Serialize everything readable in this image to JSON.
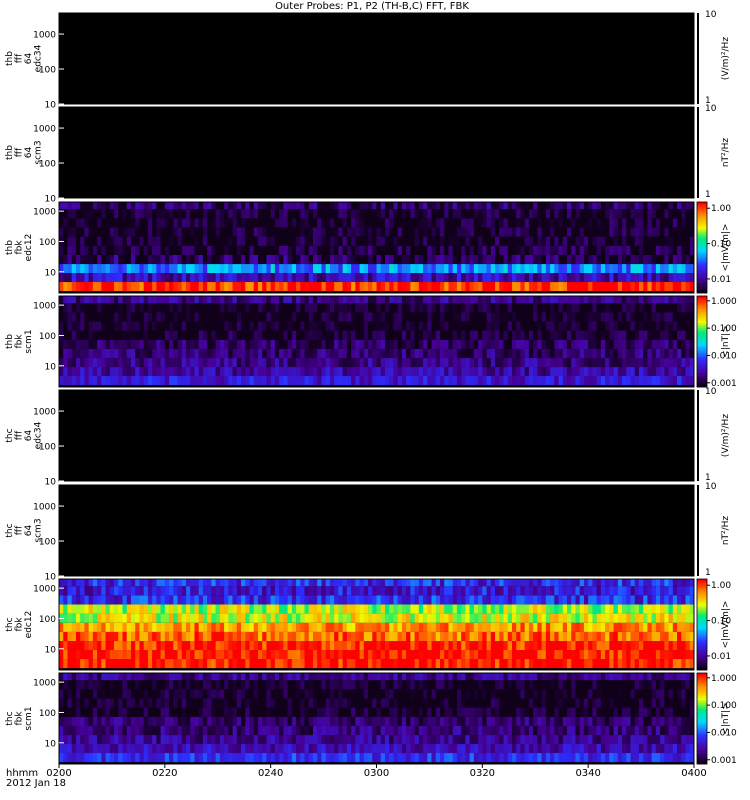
{
  "chart_data": {
    "type": "heatmap",
    "title": "Outer Probes: P1, P2 (TH-B,C) FFT, FBK",
    "time_axis": {
      "label_line1": "hhmm",
      "label_line2": "2012 Jan 18",
      "ticks": [
        "0200",
        "0220",
        "0240",
        "0300",
        "0320",
        "0340",
        "0400"
      ]
    },
    "panels": [
      {
        "ylabel": [
          "thb",
          "fff",
          "64",
          "edc34"
        ],
        "yticks": [
          "1000",
          "100",
          "10"
        ],
        "ylim": [
          10,
          4000
        ],
        "cbar_label": "(V/m)²/Hz",
        "cbar_ticks": [
          "10",
          "1"
        ],
        "cbar": "blank",
        "content": "empty",
        "bands": []
      },
      {
        "ylabel": [
          "thb",
          "fff",
          "64",
          "scm3"
        ],
        "yticks": [
          "1000",
          "100",
          "10"
        ],
        "ylim": [
          10,
          4000
        ],
        "cbar_label": "nT²/Hz",
        "cbar_ticks": [
          "10",
          "1"
        ],
        "cbar": "blank",
        "content": "empty",
        "bands": []
      },
      {
        "ylabel": [
          "thb",
          "fbk",
          "edc12"
        ],
        "yticks": [
          "1000",
          "100",
          "10"
        ],
        "ylim": [
          2,
          2000
        ],
        "cbar_label": "<|mV/m|>",
        "cbar_ticks": [
          "1.00",
          "0.10",
          "0.01"
        ],
        "cbar_range": [
          0.004,
          1.5
        ],
        "cbar": "rainbow",
        "content": "spectrogram",
        "bands": [
          {
            "f0": 2.3,
            "f1": 4.6,
            "value": 1.2
          },
          {
            "f0": 4.6,
            "f1": 9.1,
            "value": 0.012
          },
          {
            "f0": 9.1,
            "f1": 18,
            "value": 0.04
          },
          {
            "f0": 18,
            "f1": 36,
            "value": 0.006
          },
          {
            "f0": 36,
            "f1": 72,
            "value": 0.0045
          },
          {
            "f0": 72,
            "f1": 145,
            "value": 0.004
          },
          {
            "f0": 145,
            "f1": 290,
            "value": 0.004
          },
          {
            "f0": 290,
            "f1": 580,
            "value": 0.004
          },
          {
            "f0": 580,
            "f1": 1160,
            "value": 0.004
          },
          {
            "f0": 1160,
            "f1": 2000,
            "value": 0.006
          }
        ]
      },
      {
        "ylabel": [
          "thb",
          "fbk",
          "scm1"
        ],
        "yticks": [
          "1000",
          "100",
          "10"
        ],
        "ylim": [
          2,
          2000
        ],
        "cbar_label": "<|nT|>",
        "cbar_ticks": [
          "1.000",
          "0.100",
          "0.010",
          "0.001"
        ],
        "cbar_range": [
          0.0007,
          1.5
        ],
        "cbar": "rainbow",
        "content": "spectrogram",
        "bands": [
          {
            "f0": 2.3,
            "f1": 4.6,
            "value": 0.004
          },
          {
            "f0": 4.6,
            "f1": 9.1,
            "value": 0.0025
          },
          {
            "f0": 9.1,
            "f1": 18,
            "value": 0.0018
          },
          {
            "f0": 18,
            "f1": 36,
            "value": 0.0015
          },
          {
            "f0": 36,
            "f1": 72,
            "value": 0.0013
          },
          {
            "f0": 72,
            "f1": 145,
            "value": 0.0008
          },
          {
            "f0": 145,
            "f1": 290,
            "value": 0.0007
          },
          {
            "f0": 290,
            "f1": 580,
            "value": 0.0007
          },
          {
            "f0": 580,
            "f1": 1160,
            "value": 0.0007
          },
          {
            "f0": 1160,
            "f1": 2000,
            "value": 0.0018
          }
        ]
      },
      {
        "ylabel": [
          "thc",
          "fff",
          "64",
          "edc34"
        ],
        "yticks": [
          "1000",
          "100",
          "10"
        ],
        "ylim": [
          10,
          4000
        ],
        "cbar_label": "(V/m)²/Hz",
        "cbar_ticks": [
          "10",
          "1"
        ],
        "cbar": "blank",
        "content": "empty",
        "bands": []
      },
      {
        "ylabel": [
          "thc",
          "fff",
          "64",
          "scm3"
        ],
        "yticks": [
          "1000",
          "100",
          "10"
        ],
        "ylim": [
          10,
          4000
        ],
        "cbar_label": "nT²/Hz",
        "cbar_ticks": [
          "10",
          "1"
        ],
        "cbar": "blank",
        "content": "empty",
        "bands": []
      },
      {
        "ylabel": [
          "thc",
          "fbk",
          "edc12"
        ],
        "yticks": [
          "1000",
          "100",
          "10"
        ],
        "ylim": [
          2,
          2000
        ],
        "cbar_label": "<|mV/m|>",
        "cbar_ticks": [
          "1.00",
          "0.10",
          "0.01"
        ],
        "cbar_range": [
          0.004,
          1.5
        ],
        "cbar": "rainbow",
        "content": "spectrogram",
        "bands": [
          {
            "f0": 2.3,
            "f1": 4.6,
            "value": 1.4
          },
          {
            "f0": 4.6,
            "f1": 9.1,
            "value": 1.4
          },
          {
            "f0": 9.1,
            "f1": 18,
            "value": 1.3
          },
          {
            "f0": 18,
            "f1": 36,
            "value": 0.8
          },
          {
            "f0": 36,
            "f1": 72,
            "value": 0.6
          },
          {
            "f0": 72,
            "f1": 145,
            "value": 0.3
          },
          {
            "f0": 145,
            "f1": 290,
            "value": 0.25
          },
          {
            "f0": 290,
            "f1": 580,
            "value": 0.02
          },
          {
            "f0": 580,
            "f1": 1160,
            "value": 0.016
          },
          {
            "f0": 1160,
            "f1": 2000,
            "value": 0.02
          }
        ]
      },
      {
        "ylabel": [
          "thc",
          "fbk",
          "scm1"
        ],
        "yticks": [
          "1000",
          "100",
          "10"
        ],
        "ylim": [
          2,
          2000
        ],
        "cbar_label": "<|nT|>",
        "cbar_ticks": [
          "1.000",
          "0.100",
          "0.010",
          "0.001"
        ],
        "cbar_range": [
          0.0007,
          1.5
        ],
        "cbar": "rainbow",
        "content": "spectrogram",
        "bands": [
          {
            "f0": 2.3,
            "f1": 4.6,
            "value": 0.006
          },
          {
            "f0": 4.6,
            "f1": 9.1,
            "value": 0.003
          },
          {
            "f0": 9.1,
            "f1": 18,
            "value": 0.002
          },
          {
            "f0": 18,
            "f1": 36,
            "value": 0.0016
          },
          {
            "f0": 36,
            "f1": 72,
            "value": 0.0014
          },
          {
            "f0": 72,
            "f1": 145,
            "value": 0.0008
          },
          {
            "f0": 145,
            "f1": 290,
            "value": 0.0007
          },
          {
            "f0": 290,
            "f1": 580,
            "value": 0.0007
          },
          {
            "f0": 580,
            "f1": 1160,
            "value": 0.0007
          },
          {
            "f0": 1160,
            "f1": 2000,
            "value": 0.0018
          }
        ]
      }
    ]
  }
}
